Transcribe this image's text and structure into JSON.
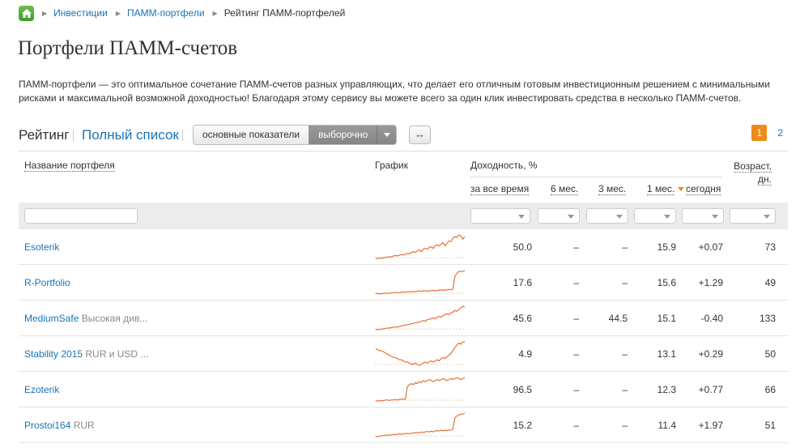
{
  "breadcrumbs": [
    "Инвестиции",
    "ПАММ-портфели",
    "Рейтинг ПАММ-портфелей"
  ],
  "page_title": "Портфели ПАММ-счетов",
  "description_line1": "ПАММ-портфели — это оптимальное сочетание ПАММ-счетов разных управляющих, что делает его отличным готовым инвестиционным решением с минимальными",
  "description_line2": "рисками и максимальной возможной доходностью! Благодаря этому сервису вы можете всего за один клик инвестировать средства в несколько ПАММ-счетов.",
  "tabs": {
    "active": "Рейтинг",
    "link": "Полный список"
  },
  "view_toggle": {
    "option1": "основные показатели",
    "option2": "выборочно"
  },
  "expand_icon": "↔",
  "pagination": {
    "current": "1",
    "next": "2"
  },
  "accent_color": "#ef8a1c",
  "link_color": "#1a73b5",
  "table": {
    "headers": {
      "name": "Название портфеля",
      "chart": "График",
      "yield": "Доходность, %",
      "all_time": "за все время",
      "m6": "6 мес.",
      "m3": "3 мес.",
      "m1": "1 мес.",
      "today": "сегодня",
      "age_line1": "Возраст,",
      "age_line2": "дн."
    },
    "rows": [
      {
        "name": "Esoterik",
        "extra": "",
        "all_time": "50.0",
        "m6": "–",
        "m3": "–",
        "m1": "15.9",
        "today": "+0.07",
        "today_sign": "pos",
        "age": "73",
        "spark": [
          5,
          5,
          5.5,
          5,
          6,
          6,
          7,
          6.5,
          7,
          8,
          8.5,
          8,
          9,
          9.5,
          9,
          10,
          11,
          10.5,
          12,
          13,
          12,
          14,
          15,
          13,
          16,
          17,
          16,
          18,
          19,
          17,
          20,
          21,
          20,
          22,
          24,
          20,
          23,
          26,
          25,
          29,
          31,
          30,
          33,
          32,
          28,
          31
        ]
      },
      {
        "name": "R-Portfolio",
        "extra": "",
        "all_time": "17.6",
        "m6": "–",
        "m3": "–",
        "m1": "15.6",
        "today": "+1.29",
        "today_sign": "pos",
        "age": "49",
        "spark": [
          6,
          6,
          5.5,
          6,
          6,
          6.5,
          6,
          6.5,
          7,
          7,
          7.5,
          7,
          7,
          7.5,
          8,
          7.5,
          8,
          8,
          8,
          8.5,
          8,
          8.5,
          9,
          8.5,
          9,
          9,
          8.5,
          9,
          9,
          9.5,
          9,
          9,
          10,
          10,
          9.5,
          10,
          10,
          10.5,
          10,
          11,
          25,
          28,
          30,
          30,
          30,
          31
        ]
      },
      {
        "name": "MediumSafe",
        "extra": " Высокая див...",
        "all_time": "45.6",
        "m6": "–",
        "m3": "44.5",
        "m1": "15.1",
        "today": "-0.40",
        "today_sign": "neg",
        "age": "133",
        "spark": [
          4,
          4.5,
          4,
          5,
          5,
          5.5,
          6,
          6,
          6.5,
          7,
          7.5,
          7,
          8,
          8.5,
          9,
          9.5,
          10,
          10.5,
          11,
          11.5,
          12,
          12.5,
          13,
          14,
          15,
          14,
          16,
          16.5,
          17,
          18,
          17,
          19,
          20,
          19,
          21,
          22,
          23,
          22,
          24,
          25,
          27,
          26,
          28,
          30,
          32,
          31
        ]
      },
      {
        "name": "Stability 2015",
        "extra": " RUR и USD ...",
        "all_time": "4.9",
        "m6": "–",
        "m3": "–",
        "m1": "13.1",
        "today": "+0.29",
        "today_sign": "pos",
        "age": "50",
        "spark": [
          24,
          23,
          22,
          22,
          21,
          20,
          19,
          18,
          17,
          16,
          16,
          15,
          14,
          14,
          13,
          12,
          12,
          11,
          10,
          10,
          11,
          10,
          9,
          10,
          11,
          12,
          11,
          12,
          13,
          12,
          13,
          14,
          13,
          15,
          16,
          15,
          17,
          18,
          20,
          22,
          25,
          27,
          29,
          28,
          30,
          30
        ]
      },
      {
        "name": "Ezoterik",
        "extra": "",
        "all_time": "96.5",
        "m6": "–",
        "m3": "–",
        "m1": "12.3",
        "today": "+0.77",
        "today_sign": "pos",
        "age": "66",
        "spark": [
          8,
          8,
          8.5,
          8,
          8.5,
          9,
          9,
          8.5,
          9,
          9,
          9.5,
          9,
          9.5,
          10,
          9.5,
          10,
          22,
          24,
          25,
          24,
          26,
          25,
          27,
          26,
          28,
          27,
          28,
          29,
          28,
          27,
          28,
          29,
          28,
          29,
          30,
          29,
          28,
          29,
          30,
          29,
          30,
          31,
          30,
          29,
          30,
          31
        ]
      },
      {
        "name": "Prostoi164",
        "extra": " RUR",
        "all_time": "15.2",
        "m6": "–",
        "m3": "–",
        "m1": "11.4",
        "today": "+1.97",
        "today_sign": "pos",
        "age": "51",
        "spark": [
          6,
          6,
          6.5,
          7,
          7,
          7.5,
          8,
          7.5,
          8,
          8.5,
          8,
          8.5,
          9,
          8.5,
          9,
          9,
          9.5,
          9,
          9.5,
          10,
          10,
          10.5,
          10,
          11,
          10.5,
          11,
          11.5,
          11,
          12,
          11,
          12,
          12.5,
          12,
          13,
          12,
          13,
          12.5,
          13,
          13,
          14,
          26,
          28,
          29,
          30,
          30,
          31
        ]
      }
    ]
  }
}
